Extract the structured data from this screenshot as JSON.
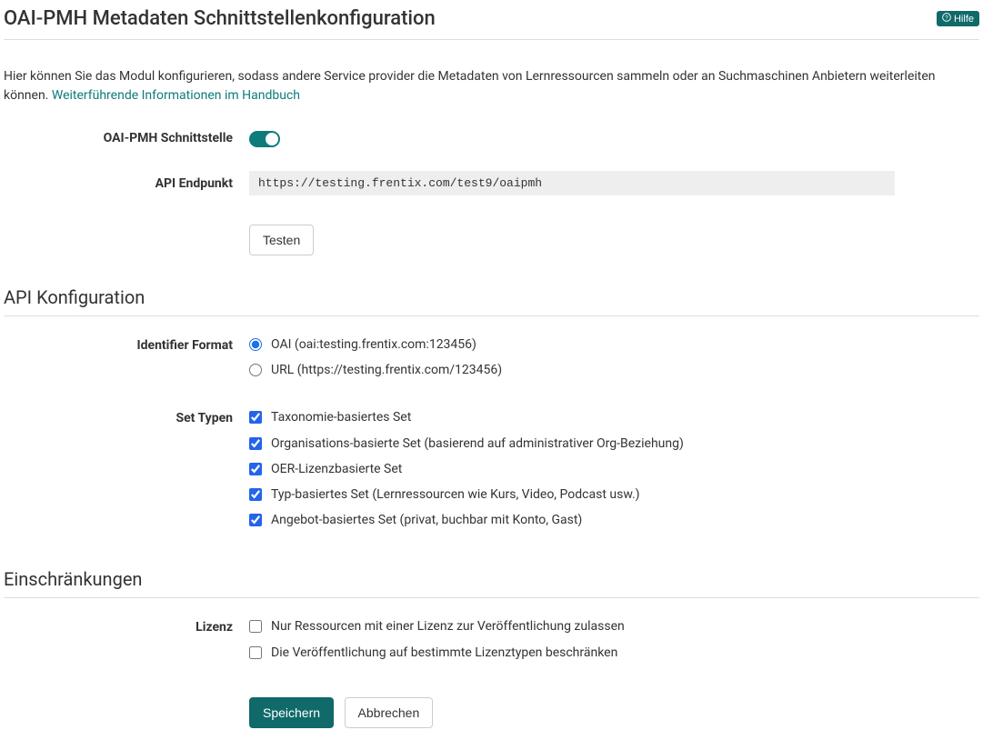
{
  "header": {
    "title": "OAI-PMH Metadaten Schnittstellenkonfiguration",
    "help_label": "Hilfe"
  },
  "intro": {
    "text_before_link": "Hier können Sie das Modul konfigurieren, sodass andere Service provider die Metadaten von Lernressourcen sammeln oder an Suchmaschinen Anbietern weiterleiten können. ",
    "link_text": "Weiterführende Informationen im Handbuch"
  },
  "interface": {
    "label": "OAI-PMH Schnittstelle",
    "enabled": true
  },
  "endpoint": {
    "label": "API Endpunkt",
    "value": "https://testing.frentix.com/test9/oaipmh",
    "test_button": "Testen"
  },
  "api_config": {
    "heading": "API Konfiguration",
    "identifier_format": {
      "label": "Identifier Format",
      "options": [
        {
          "value": "oai",
          "label": "OAI (oai:testing.frentix.com:123456)",
          "checked": true
        },
        {
          "value": "url",
          "label": "URL (https://testing.frentix.com/123456)",
          "checked": false
        }
      ]
    },
    "set_types": {
      "label": "Set Typen",
      "options": [
        {
          "label": "Taxonomie-basiertes Set",
          "checked": true
        },
        {
          "label": "Organisations-basierte Set (basierend auf administrativer Org-Beziehung)",
          "checked": true
        },
        {
          "label": "OER-Lizenzbasierte Set",
          "checked": true
        },
        {
          "label": "Typ-basiertes Set (Lernressourcen wie Kurs, Video, Podcast usw.)",
          "checked": true
        },
        {
          "label": "Angebot-basiertes Set (privat, buchbar mit Konto, Gast)",
          "checked": true
        }
      ]
    }
  },
  "restrictions": {
    "heading": "Einschränkungen",
    "license": {
      "label": "Lizenz",
      "options": [
        {
          "label": "Nur Ressourcen mit einer Lizenz zur Veröffentlichung zulassen",
          "checked": false
        },
        {
          "label": "Die Veröffentlichung auf bestimmte Lizenztypen beschränken",
          "checked": false
        }
      ]
    }
  },
  "buttons": {
    "save": "Speichern",
    "cancel": "Abbrechen"
  }
}
